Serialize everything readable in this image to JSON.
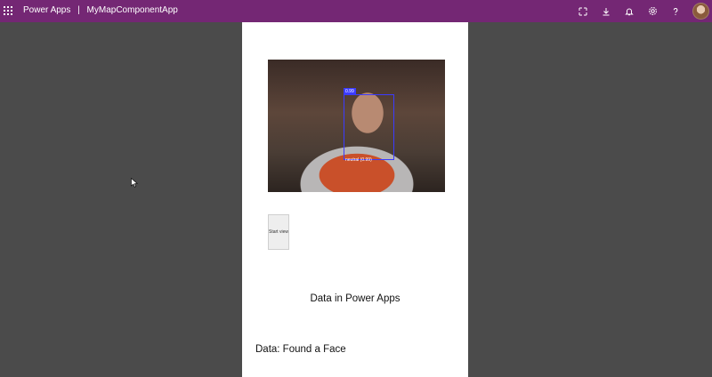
{
  "topbar": {
    "app_name": "Power Apps",
    "separator": "|",
    "document_title": "MyMapComponentApp",
    "icons": [
      "app-launcher-icon",
      "fit-to-window-icon",
      "download-icon",
      "bell-icon",
      "gear-icon",
      "help-icon",
      "avatar"
    ]
  },
  "canvas": {
    "camera": {
      "face_tag": "0.99",
      "face_label": "neutral (0.99)"
    },
    "start_button_label": "Start view",
    "heading": "Data in Power Apps",
    "data_text": "Data: Found a Face"
  },
  "colors": {
    "topbar": "#742774",
    "background": "#4b4b4b",
    "canvas": "#ffffff",
    "face_box": "#3b3bff"
  }
}
